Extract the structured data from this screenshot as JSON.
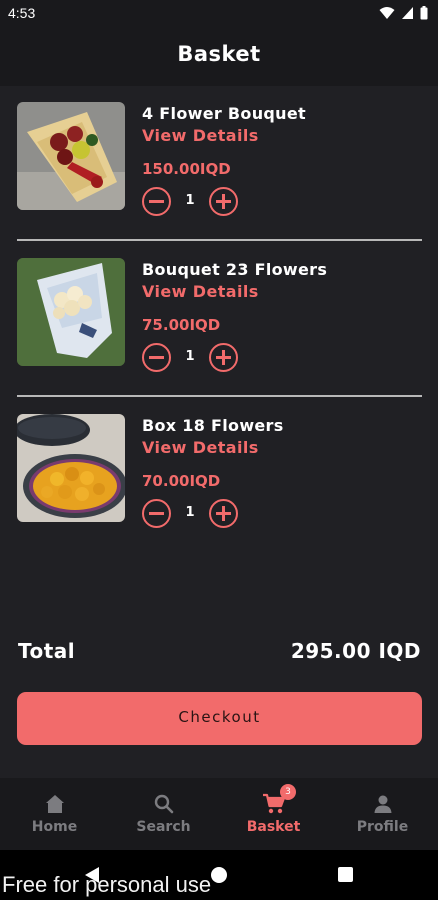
{
  "status_bar": {
    "time": "4:53"
  },
  "header": {
    "title": "Basket"
  },
  "items": [
    {
      "name": "4 Flower Bouquet",
      "details_label": "View Details",
      "price": "150.00IQD",
      "quantity": "1"
    },
    {
      "name": "Bouquet 23 Flowers",
      "details_label": "View Details",
      "price": "75.00IQD",
      "quantity": "1"
    },
    {
      "name": "Box 18 Flowers",
      "details_label": "View Details",
      "price": "70.00IQD",
      "quantity": "1"
    }
  ],
  "summary": {
    "total_label": "Total",
    "total_value": "295.00 IQD"
  },
  "checkout": {
    "label": "Checkout"
  },
  "nav": {
    "items": [
      {
        "label": "Home",
        "icon": "home-icon"
      },
      {
        "label": "Search",
        "icon": "search-icon"
      },
      {
        "label": "Basket",
        "icon": "cart-icon",
        "badge": "3",
        "active": true
      },
      {
        "label": "Profile",
        "icon": "person-icon"
      }
    ]
  },
  "watermark": "Free for personal use",
  "colors": {
    "accent": "#f26b6b",
    "background": "#202024",
    "bar": "#19191c",
    "inactive": "#7c7c80"
  }
}
